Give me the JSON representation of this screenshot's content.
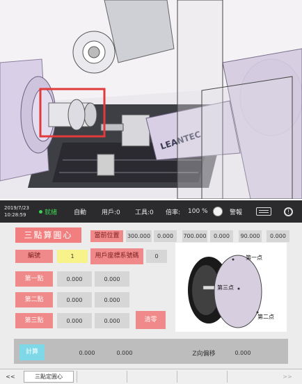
{
  "colors": {
    "status_bg": "#2b2b2d",
    "accent_red_button": "#f27f7f",
    "running_green": "#39d353",
    "value_bg": "#d6d6d6",
    "highlight_yellow": "#f7f28a",
    "calc_button": "#7fd8e8"
  },
  "scene": {
    "brand_text": "LEANTEC"
  },
  "status": {
    "date": "2019/7/23",
    "time": "10:28:59",
    "running_label": "就緒",
    "mode_label": "自動",
    "user_label": "用戶:0",
    "tool_label": "工具:0",
    "rate_label": "倍率:",
    "rate_value": "100 %",
    "alarm_label": "警報",
    "keyboard_icon": "keyboard-icon",
    "info_icon": "info-icon"
  },
  "panel": {
    "title": "三點算圓心",
    "current_pos_label": "當前位置",
    "current_pos_values": [
      "300.000",
      "0.000",
      "700.000",
      "0.000",
      "90.000",
      "0.000"
    ],
    "id_label": "編號",
    "id_value": "1",
    "user_coord_label": "用戶座標系號碼",
    "user_coord_value": "0",
    "point_rows": [
      {
        "label": "第一點",
        "x": "0.000",
        "y": "0.000"
      },
      {
        "label": "第二點",
        "x": "0.000",
        "y": "0.000"
      },
      {
        "label": "第三點",
        "x": "0.000",
        "y": "0.000"
      }
    ],
    "clear_label": "清零",
    "calc_label": "計算",
    "result_x": "0.000",
    "result_y": "0.000",
    "z_offset_label": "Z向偏移",
    "z_offset_value": "0.000"
  },
  "diagram": {
    "point1": "第一点",
    "point2": "第二点",
    "point3": "第三点"
  },
  "tabs": {
    "prev": "<<",
    "active": "三點定圓心",
    "next": ">>"
  }
}
